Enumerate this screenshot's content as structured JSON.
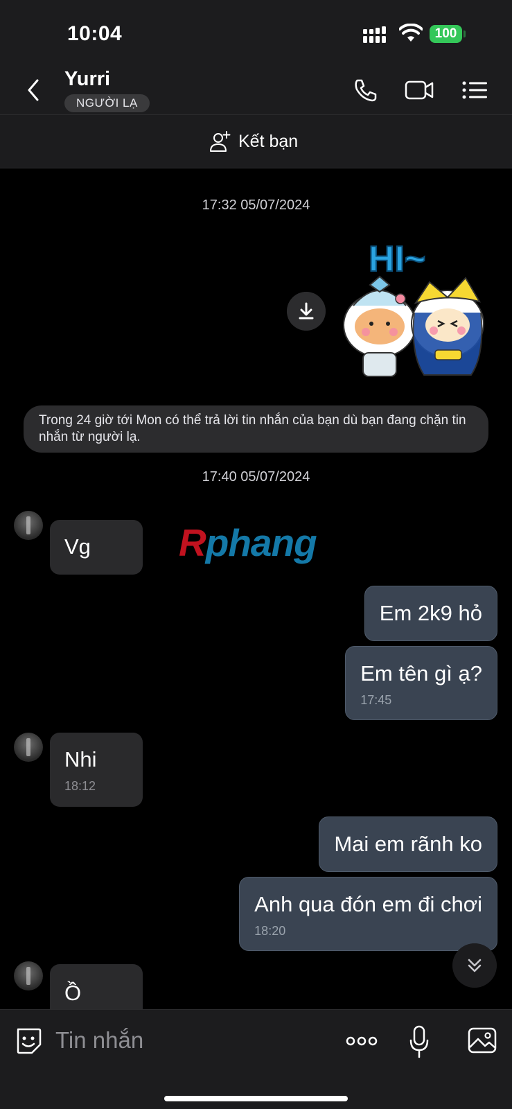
{
  "status_bar": {
    "time": "10:04",
    "battery": "100",
    "icons": [
      "signal-icon",
      "wifi-icon",
      "battery-icon"
    ]
  },
  "header": {
    "contact_name": "Yurri",
    "badge": "NGƯỜI LẠ",
    "icons": [
      "back-icon",
      "phone-icon",
      "video-call-icon",
      "menu-list-icon"
    ]
  },
  "add_friend": {
    "label": "Kết bạn",
    "icon": "add-user-icon"
  },
  "chat": {
    "timestamps": [
      "17:32 05/07/2024",
      "17:40 05/07/2024"
    ],
    "sticker_text": "HI~",
    "notice": "Trong 24 giờ tới Mon có thể trả lời tin nhắn của bạn dù bạn đang chặn tin nhắn từ người lạ.",
    "watermark": {
      "r": "R",
      "rest": "phang"
    },
    "messages": [
      {
        "from": "them",
        "text": "Vg"
      },
      {
        "from": "me",
        "text": "Em 2k9 hỏ"
      },
      {
        "from": "me",
        "text": "Em tên gì ạ?",
        "time": "17:45"
      },
      {
        "from": "them",
        "text": "Nhi",
        "time": "18:12"
      },
      {
        "from": "me",
        "text": "Mai em rãnh ko"
      },
      {
        "from": "me",
        "text": "Anh qua đón em đi chơi",
        "time": "18:20"
      },
      {
        "from": "them",
        "text": "Ồ"
      }
    ]
  },
  "input_bar": {
    "placeholder": "Tin nhắn",
    "icons": [
      "sticker-icon",
      "more-icon",
      "microphone-icon",
      "image-icon"
    ]
  },
  "colors": {
    "background": "#000000",
    "bar": "#1c1c1e",
    "bubble_in": "#2a2a2c",
    "bubble_out": "#3a4452",
    "battery": "#34c759"
  }
}
